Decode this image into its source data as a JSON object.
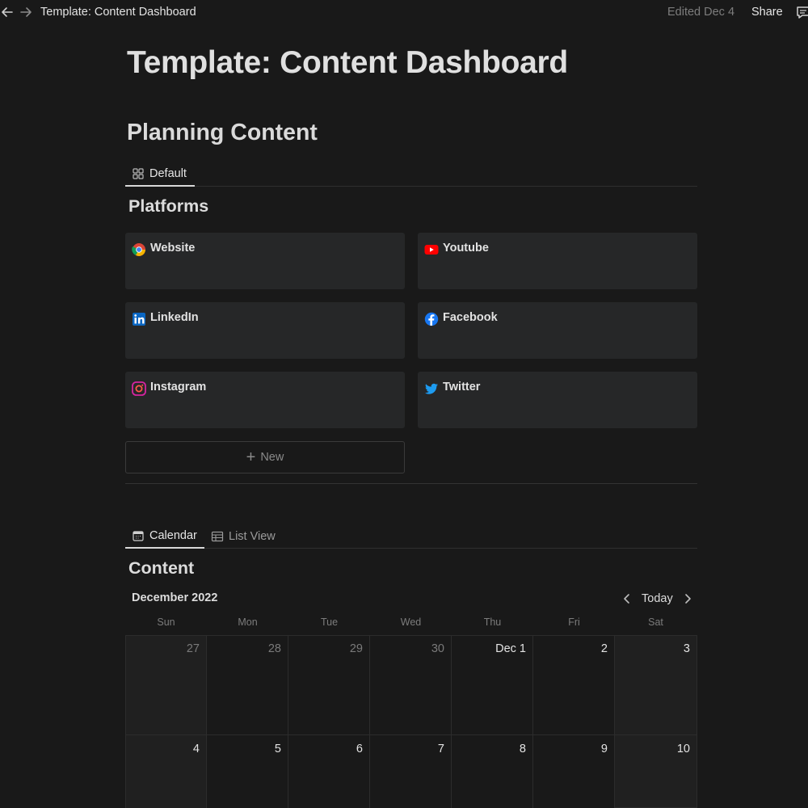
{
  "topbar": {
    "breadcrumb": "Template: Content Dashboard",
    "edited": "Edited Dec 4",
    "share_label": "Share",
    "icons": [
      "arrow-left-icon",
      "arrow-right-icon",
      "comment-icon"
    ]
  },
  "page": {
    "title": "Template: Content Dashboard"
  },
  "planning": {
    "heading": "Planning Content",
    "tabs": [
      {
        "label": "Default",
        "icon": "gallery-icon",
        "active": true
      }
    ],
    "gallery_title": "Platforms",
    "cards": [
      {
        "label": "Website",
        "icon": "chrome-icon"
      },
      {
        "label": "Youtube",
        "icon": "youtube-icon"
      },
      {
        "label": "LinkedIn",
        "icon": "linkedin-icon"
      },
      {
        "label": "Facebook",
        "icon": "facebook-icon"
      },
      {
        "label": "Instagram",
        "icon": "instagram-icon"
      },
      {
        "label": "Twitter",
        "icon": "twitter-icon"
      }
    ],
    "new_label": "New"
  },
  "content": {
    "tabs": [
      {
        "label": "Calendar",
        "icon": "calendar-icon",
        "active": true
      },
      {
        "label": "List View",
        "icon": "table-icon",
        "active": false
      }
    ],
    "title": "Content",
    "month": "December 2022",
    "today_label": "Today",
    "weekdays": [
      "Sun",
      "Mon",
      "Tue",
      "Wed",
      "Thu",
      "Fri",
      "Sat"
    ],
    "weeks": [
      [
        "27",
        "28",
        "29",
        "30",
        "Dec 1",
        "2",
        "3"
      ],
      [
        "4",
        "5",
        "6",
        "7",
        "8",
        "9",
        "10"
      ]
    ]
  },
  "colors": {
    "background": "#191919",
    "card": "#262728",
    "youtube": "#ff0000",
    "facebook": "#1877f2",
    "linkedin": "#0a66c2",
    "twitter": "#1d9bf0"
  }
}
